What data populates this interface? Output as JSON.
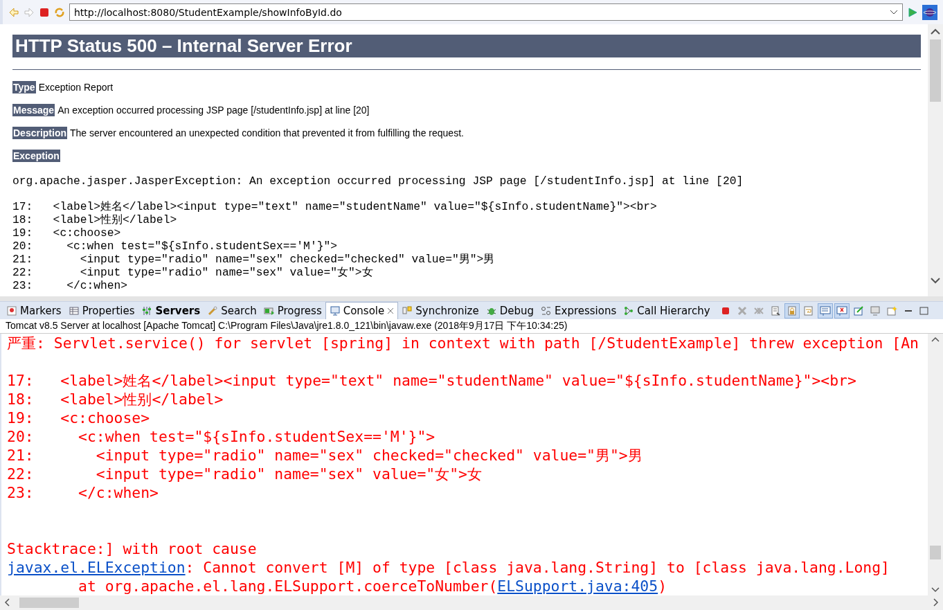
{
  "browser": {
    "url": "http://localhost:8080/StudentExample/showInfoById.do",
    "heading": "HTTP Status 500 – Internal Server Error",
    "fields": [
      {
        "label": "Type",
        "value": "Exception Report"
      },
      {
        "label": "Message",
        "value": "An exception occurred processing JSP page [/studentInfo.jsp] at line [20]"
      },
      {
        "label": "Description",
        "value": "The server encountered an unexpected condition that prevented it from fulfilling the request."
      },
      {
        "label": "Exception"
      }
    ],
    "exception": "org.apache.jasper.JasperException: An exception occurred processing JSP page [/studentInfo.jsp] at line [20]",
    "code_lines": [
      "17:   <label>姓名</label><input type=\"text\" name=\"studentName\" value=\"${sInfo.studentName}\"><br>",
      "18:   <label>性别</label>",
      "19:   <c:choose>",
      "20:     <c:when test=\"${sInfo.studentSex=='M'}\">",
      "21:       <input type=\"radio\" name=\"sex\" checked=\"checked\" value=\"男\">男",
      "22:       <input type=\"radio\" name=\"sex\" value=\"女\">女",
      "23:     </c:when>"
    ]
  },
  "tabs": [
    {
      "label": "Markers",
      "kind": "markers",
      "selected": false,
      "bold": false
    },
    {
      "label": "Properties",
      "kind": "properties",
      "selected": false,
      "bold": false
    },
    {
      "label": "Servers",
      "kind": "servers",
      "selected": false,
      "bold": true
    },
    {
      "label": "Search",
      "kind": "search",
      "selected": false,
      "bold": false
    },
    {
      "label": "Progress",
      "kind": "progress",
      "selected": false,
      "bold": false
    },
    {
      "label": "Console",
      "kind": "console",
      "selected": true,
      "bold": false
    },
    {
      "label": "Synchronize",
      "kind": "synchronize",
      "selected": false,
      "bold": false
    },
    {
      "label": "Debug",
      "kind": "debug",
      "selected": false,
      "bold": false
    },
    {
      "label": "Expressions",
      "kind": "expressions",
      "selected": false,
      "bold": false
    },
    {
      "label": "Call Hierarchy",
      "kind": "hierarchy",
      "selected": false,
      "bold": false
    }
  ],
  "console_toolbar": [
    {
      "kind": "terminate",
      "pressed": false
    },
    {
      "kind": "remove",
      "pressed": false
    },
    {
      "kind": "remove-all",
      "pressed": false
    },
    {
      "kind": "clear",
      "pressed": false
    },
    {
      "kind": "scroll-lock",
      "pressed": true
    },
    {
      "kind": "word-wrap",
      "pressed": false
    },
    {
      "kind": "stdout",
      "pressed": true
    },
    {
      "kind": "stderr",
      "pressed": true
    },
    {
      "kind": "pin",
      "pressed": false
    },
    {
      "kind": "display",
      "pressed": false
    },
    {
      "kind": "new-console",
      "pressed": false
    }
  ],
  "console": {
    "title": "Tomcat v8.5 Server at localhost [Apache Tomcat] C:\\Program Files\\Java\\jre1.8.0_121\\bin\\javaw.exe (2018年9月17日 下午10:34:25)",
    "lines": [
      {
        "kind": "text",
        "parts": [
          {
            "kind": "text",
            "text": "严重: Servlet.service() for servlet [spring] in context with path [/StudentExample] threw exception [An"
          }
        ]
      },
      {
        "kind": "blank"
      },
      {
        "kind": "text",
        "parts": [
          {
            "kind": "text",
            "text": "17:   <label>姓名</label><input type=\"text\" name=\"studentName\" value=\"${sInfo.studentName}\"><br>"
          }
        ]
      },
      {
        "kind": "text",
        "parts": [
          {
            "kind": "text",
            "text": "18:   <label>性别</label>"
          }
        ]
      },
      {
        "kind": "text",
        "parts": [
          {
            "kind": "text",
            "text": "19:   <c:choose>"
          }
        ]
      },
      {
        "kind": "text",
        "parts": [
          {
            "kind": "text",
            "text": "20:     <c:when test=\"${sInfo.studentSex=='M'}\">"
          }
        ]
      },
      {
        "kind": "text",
        "parts": [
          {
            "kind": "text",
            "text": "21:       <input type=\"radio\" name=\"sex\" checked=\"checked\" value=\"男\">男"
          }
        ]
      },
      {
        "kind": "text",
        "parts": [
          {
            "kind": "text",
            "text": "22:       <input type=\"radio\" name=\"sex\" value=\"女\">女"
          }
        ]
      },
      {
        "kind": "text",
        "parts": [
          {
            "kind": "text",
            "text": "23:     </c:when>"
          }
        ]
      },
      {
        "kind": "blank"
      },
      {
        "kind": "blank"
      },
      {
        "kind": "text",
        "parts": [
          {
            "kind": "text",
            "text": "Stacktrace:] with root cause"
          }
        ]
      },
      {
        "kind": "text",
        "parts": [
          {
            "kind": "link",
            "text": "javax.el.ELException"
          },
          {
            "kind": "text",
            "text": ": Cannot convert [M] of type [class java.lang.String] to [class java.lang.Long]"
          }
        ]
      },
      {
        "kind": "text",
        "parts": [
          {
            "kind": "text",
            "text": "\tat org.apache.el.lang.ELSupport.coerceToNumber("
          },
          {
            "kind": "link",
            "text": "ELSupport.java:405"
          },
          {
            "kind": "text",
            "text": ")"
          }
        ]
      }
    ]
  }
}
